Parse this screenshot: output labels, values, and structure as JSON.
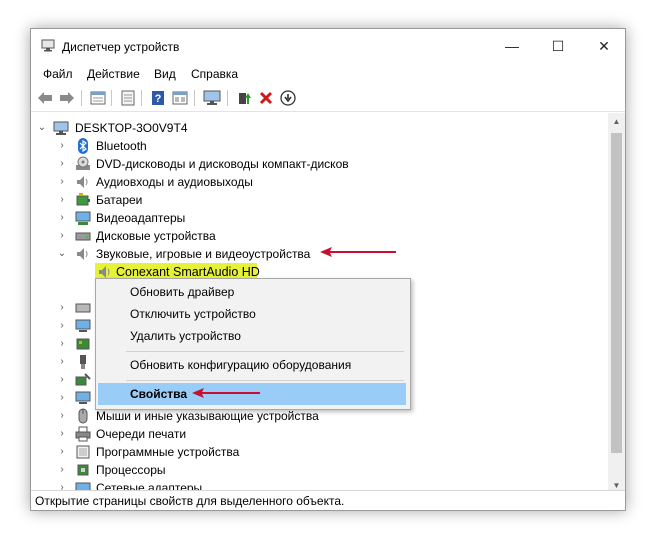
{
  "window": {
    "title": "Диспетчер устройств",
    "minimize_glyph": "—",
    "maximize_glyph": "☐",
    "close_glyph": "✕"
  },
  "menu": [
    "Файл",
    "Действие",
    "Вид",
    "Справка"
  ],
  "toolbar": [
    "back-icon",
    "forward-icon",
    "properties-icon",
    "update-icon",
    "help-icon",
    "view-icon",
    "monitor-icon",
    "add-driver-icon",
    "remove-icon",
    "download-icon"
  ],
  "tree": {
    "root": "DESKTOP-3O0V9T4",
    "items": [
      {
        "label": "Bluetooth",
        "icon": "bluetooth-icon"
      },
      {
        "label": "DVD-дисководы и дисководы компакт-дисков",
        "icon": "dvd-icon"
      },
      {
        "label": "Аудиовходы и аудиовыходы",
        "icon": "speaker-icon"
      },
      {
        "label": "Батареи",
        "icon": "battery-icon"
      },
      {
        "label": "Видеоадаптеры",
        "icon": "display-adapter-icon"
      },
      {
        "label": "Дисковые устройства",
        "icon": "disk-icon"
      },
      {
        "label": "Звуковые, игровые и видеоустройства",
        "icon": "speaker-icon"
      },
      {
        "label": "Conexant SmartAudio HD",
        "icon": "speaker-icon"
      },
      {
        "label": "",
        "icon": "generic-device-icon"
      },
      {
        "label": "",
        "icon": "monitor-icon"
      },
      {
        "label": "",
        "icon": "network-icon"
      },
      {
        "label": "",
        "icon": "usb-icon"
      },
      {
        "label": "",
        "icon": "controller-icon"
      },
      {
        "label": "",
        "icon": "monitor-icon"
      },
      {
        "label": "Мыши и иные указывающие устройства",
        "icon": "mouse-icon"
      },
      {
        "label": "Очереди печати",
        "icon": "printer-icon"
      },
      {
        "label": "Программные устройства",
        "icon": "software-device-icon"
      },
      {
        "label": "Процессоры",
        "icon": "cpu-icon"
      },
      {
        "label": "Сетевые адаптеры",
        "icon": "network-adapter-icon"
      }
    ]
  },
  "context_menu": {
    "items": [
      "Обновить драйвер",
      "Отключить устройство",
      "Удалить устройство",
      "Обновить конфигурацию оборудования",
      "Свойства"
    ],
    "highlighted": "Свойства"
  },
  "status_bar": "Открытие страницы свойств для выделенного объекта.",
  "colors": {
    "highlight": "#99ccf7",
    "device_highlight": "#e6f23a",
    "arrow": "#c8102e"
  }
}
